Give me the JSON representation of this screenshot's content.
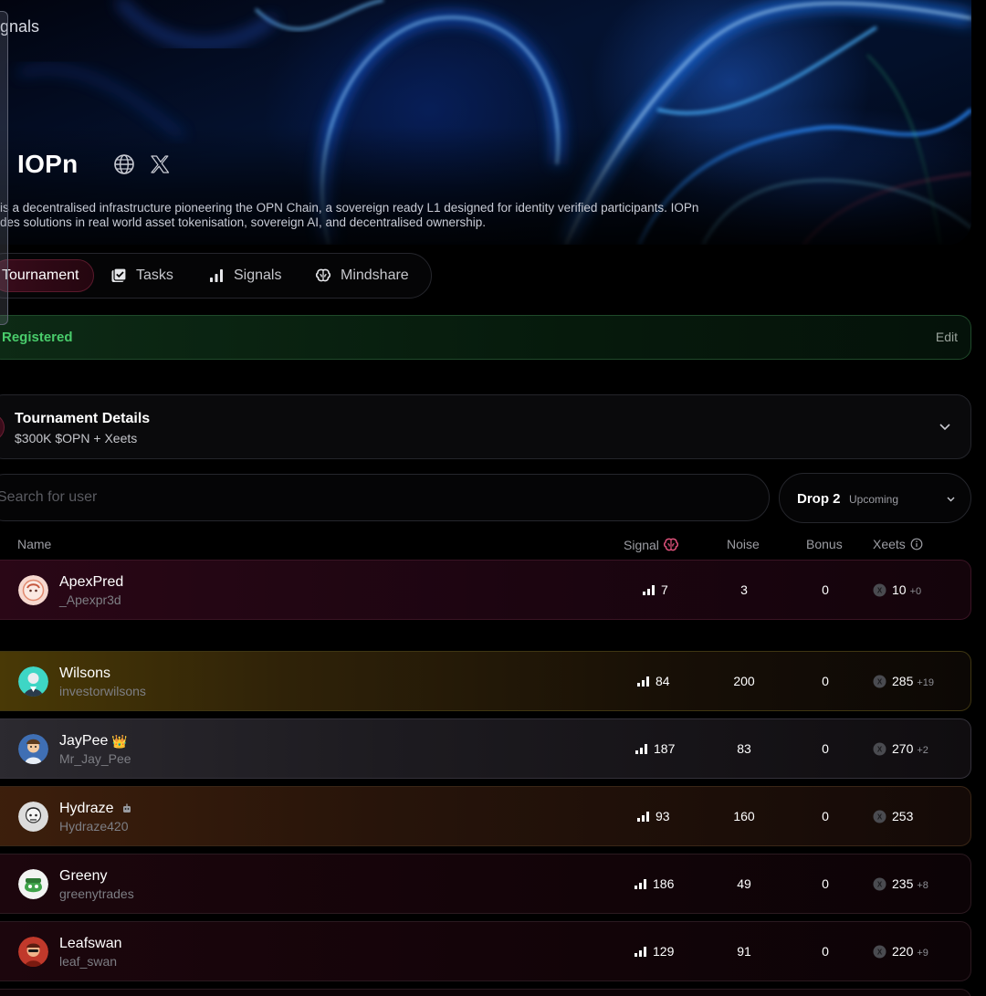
{
  "hero": {
    "label": "gnals",
    "title": "IOPn",
    "description_line1": "is a decentralised infrastructure pioneering the OPN Chain, a sovereign ready L1 designed for identity verified participants. IOPn",
    "description_line2": "des solutions in real world asset tokenisation, sovereign AI, and decentralised ownership.",
    "icons": [
      "globe-icon",
      "x-logo-icon"
    ]
  },
  "tabs": [
    {
      "label": "Tournament",
      "icon": "none",
      "active": true
    },
    {
      "label": "Tasks",
      "icon": "checklist-icon",
      "active": false
    },
    {
      "label": "Signals",
      "icon": "bar-chart-icon",
      "active": false
    },
    {
      "label": "Mindshare",
      "icon": "brain-icon",
      "active": false
    }
  ],
  "registration": {
    "status": "Registered",
    "edit_label": "Edit"
  },
  "tournament_details": {
    "title": "Tournament Details",
    "prize": "$300K $OPN + Xeets"
  },
  "search": {
    "placeholder": "Search for user"
  },
  "drop_select": {
    "label": "Drop 2",
    "status": "Upcoming"
  },
  "table": {
    "headers": {
      "name": "Name",
      "signal": "Signal",
      "noise": "Noise",
      "bonus": "Bonus",
      "xeets": "Xeets"
    },
    "current_user": {
      "name": "ApexPred",
      "handle": "_Apexpr3d",
      "signal": "7",
      "noise": "3",
      "bonus": "0",
      "xeets": "10",
      "xeets_delta": "+0"
    },
    "rows": [
      {
        "name": "Wilsons",
        "handle": "investorwilsons",
        "signal": "84",
        "noise": "200",
        "bonus": "0",
        "xeets": "285",
        "xeets_delta": "+19",
        "badge": ""
      },
      {
        "name": "JayPee",
        "handle": "Mr_Jay_Pee",
        "signal": "187",
        "noise": "83",
        "bonus": "0",
        "xeets": "270",
        "xeets_delta": "+2",
        "badge": "👑"
      },
      {
        "name": "Hydraze",
        "handle": "Hydraze420",
        "signal": "93",
        "noise": "160",
        "bonus": "0",
        "xeets": "253",
        "xeets_delta": "",
        "badge": ""
      },
      {
        "name": "Greeny",
        "handle": "greenytrades",
        "signal": "186",
        "noise": "49",
        "bonus": "0",
        "xeets": "235",
        "xeets_delta": "+8",
        "badge": ""
      },
      {
        "name": "Leafswan",
        "handle": "leaf_swan",
        "signal": "129",
        "noise": "91",
        "bonus": "0",
        "xeets": "220",
        "xeets_delta": "+9",
        "badge": ""
      }
    ]
  },
  "colors": {
    "accent_red": "#5a1a2c",
    "registered_green": "#49cc6b",
    "background": "#000000"
  }
}
